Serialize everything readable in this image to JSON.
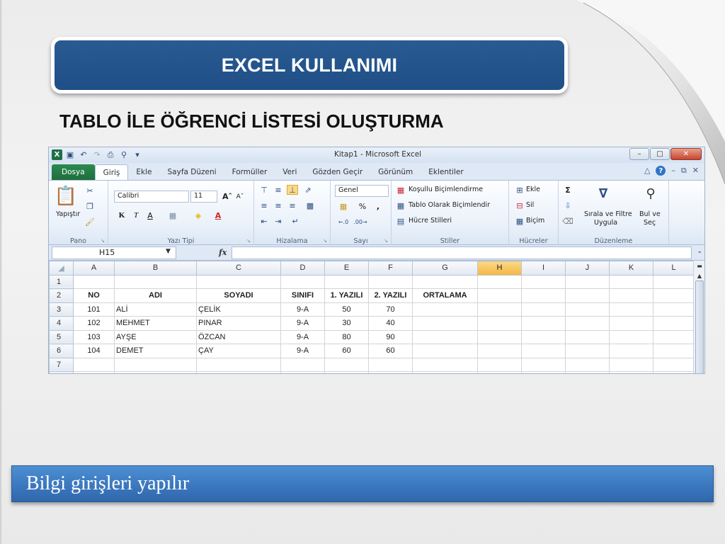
{
  "slide": {
    "title": "EXCEL KULLANIMI",
    "subtitle": "TABLO İLE ÖĞRENCİ LİSTESİ OLUŞTURMA",
    "footer": "Bilgi girişleri yapılır"
  },
  "excel": {
    "window_title": "Kitap1  -  Microsoft Excel",
    "tabs": [
      "Dosya",
      "Giriş",
      "Ekle",
      "Sayfa Düzeni",
      "Formüller",
      "Veri",
      "Gözden Geçir",
      "Görünüm",
      "Eklentiler"
    ],
    "active_tab": "Giriş",
    "ribbon": {
      "clipboard": {
        "paste": "Yapıştır",
        "label": "Pano"
      },
      "font": {
        "name": "Calibri",
        "size": "11",
        "bold": "K",
        "italic": "T",
        "underline": "A",
        "label": "Yazı Tipi"
      },
      "alignment": {
        "label": "Hizalama"
      },
      "number": {
        "format": "Genel",
        "percent": "%",
        "comma": ",",
        "label": "Sayı"
      },
      "styles": {
        "conditional": "Koşullu Biçimlendirme",
        "as_table": "Tablo Olarak Biçimlendir",
        "cell_styles": "Hücre Stilleri",
        "label": "Stiller"
      },
      "cells": {
        "insert": "Ekle",
        "delete": "Sil",
        "format": "Biçim",
        "label": "Hücreler"
      },
      "editing": {
        "sum": "Σ",
        "sort_line1": "Sırala ve Filtre",
        "sort_line2": "Uygula",
        "find_line1": "Bul ve",
        "find_line2": "Seç",
        "label": "Düzenleme"
      }
    },
    "name_box": "H15",
    "fx": "fx",
    "selected_column": "H",
    "columns": [
      "A",
      "B",
      "C",
      "D",
      "E",
      "F",
      "G",
      "H",
      "I",
      "J",
      "K",
      "L"
    ],
    "rows": [
      {
        "num": "1",
        "cells": [
          "",
          "",
          "",
          "",
          "",
          "",
          "",
          "",
          "",
          "",
          "",
          ""
        ]
      },
      {
        "num": "2",
        "cells": [
          "NO",
          "ADI",
          "SOYADI",
          "SINIFI",
          "1. YAZILI",
          "2. YAZILI",
          "ORTALAMA",
          "",
          "",
          "",
          "",
          ""
        ]
      },
      {
        "num": "3",
        "cells": [
          "101",
          "ALİ",
          "ÇELİK",
          "9-A",
          "50",
          "70",
          "",
          "",
          "",
          "",
          "",
          ""
        ]
      },
      {
        "num": "4",
        "cells": [
          "102",
          "MEHMET",
          "PINAR",
          "9-A",
          "30",
          "40",
          "",
          "",
          "",
          "",
          "",
          ""
        ]
      },
      {
        "num": "5",
        "cells": [
          "103",
          "AYŞE",
          "ÖZCAN",
          "9-A",
          "80",
          "90",
          "",
          "",
          "",
          "",
          "",
          ""
        ]
      },
      {
        "num": "6",
        "cells": [
          "104",
          "DEMET",
          "ÇAY",
          "9-A",
          "60",
          "60",
          "",
          "",
          "",
          "",
          "",
          ""
        ]
      },
      {
        "num": "7",
        "cells": [
          "",
          "",
          "",
          "",
          "",
          "",
          "",
          "",
          "",
          "",
          "",
          ""
        ]
      },
      {
        "num": "",
        "cells": [
          "",
          "",
          "",
          "",
          "",
          "",
          "",
          "",
          "",
          "",
          "",
          ""
        ]
      }
    ]
  },
  "colors": {
    "title_bar": "#1f4f86",
    "footer_bar": "#3a76bd",
    "file_tab": "#1e6e3c",
    "selected_header": "#f4b642"
  }
}
